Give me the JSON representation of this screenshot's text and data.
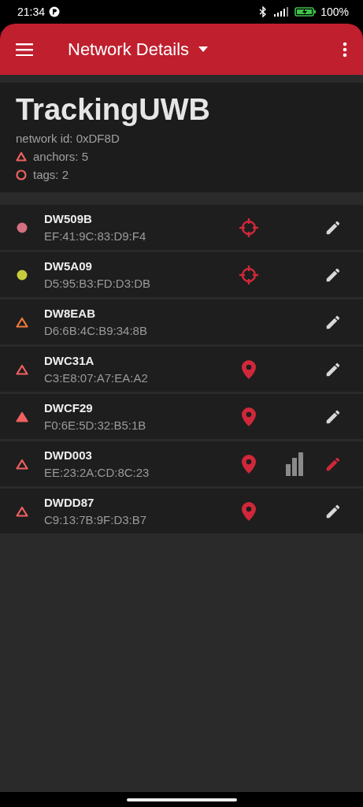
{
  "status_bar": {
    "time": "21:34",
    "battery": "100%"
  },
  "app_bar": {
    "title": "Network Details"
  },
  "network": {
    "name": "TrackingUWB",
    "network_id": "network id: 0xDF8D",
    "anchors": "anchors: 5",
    "tags": "tags: 2"
  },
  "devices": [
    {
      "name": "DW509B",
      "address": "EF:41:9C:83:D9:F4",
      "kind": "tag",
      "filled": true,
      "color": "#d4707f",
      "target": true,
      "pinned": false,
      "signal": false,
      "editing": false
    },
    {
      "name": "DW5A09",
      "address": "D5:95:B3:FD:D3:DB",
      "kind": "tag",
      "filled": true,
      "color": "#c8cc3c",
      "target": true,
      "pinned": false,
      "signal": false,
      "editing": false
    },
    {
      "name": "DW8EAB",
      "address": "D6:6B:4C:B9:34:8B",
      "kind": "anchor",
      "filled": false,
      "color": "#f07a3c",
      "target": false,
      "pinned": false,
      "signal": false,
      "editing": false
    },
    {
      "name": "DWC31A",
      "address": "C3:E8:07:A7:EA:A2",
      "kind": "anchor",
      "filled": false,
      "color": "#f06060",
      "target": false,
      "pinned": true,
      "signal": false,
      "editing": false
    },
    {
      "name": "DWCF29",
      "address": "F0:6E:5D:32:B5:1B",
      "kind": "anchor",
      "filled": true,
      "color": "#f06060",
      "target": false,
      "pinned": true,
      "signal": false,
      "editing": false
    },
    {
      "name": "DWD003",
      "address": "EE:23:2A:CD:8C:23",
      "kind": "anchor",
      "filled": false,
      "color": "#f06060",
      "target": false,
      "pinned": true,
      "signal": true,
      "editing": true
    },
    {
      "name": "DWDD87",
      "address": "C9:13:7B:9F:D3:B7",
      "kind": "anchor",
      "filled": false,
      "color": "#f06060",
      "target": false,
      "pinned": true,
      "signal": false,
      "editing": false
    }
  ]
}
